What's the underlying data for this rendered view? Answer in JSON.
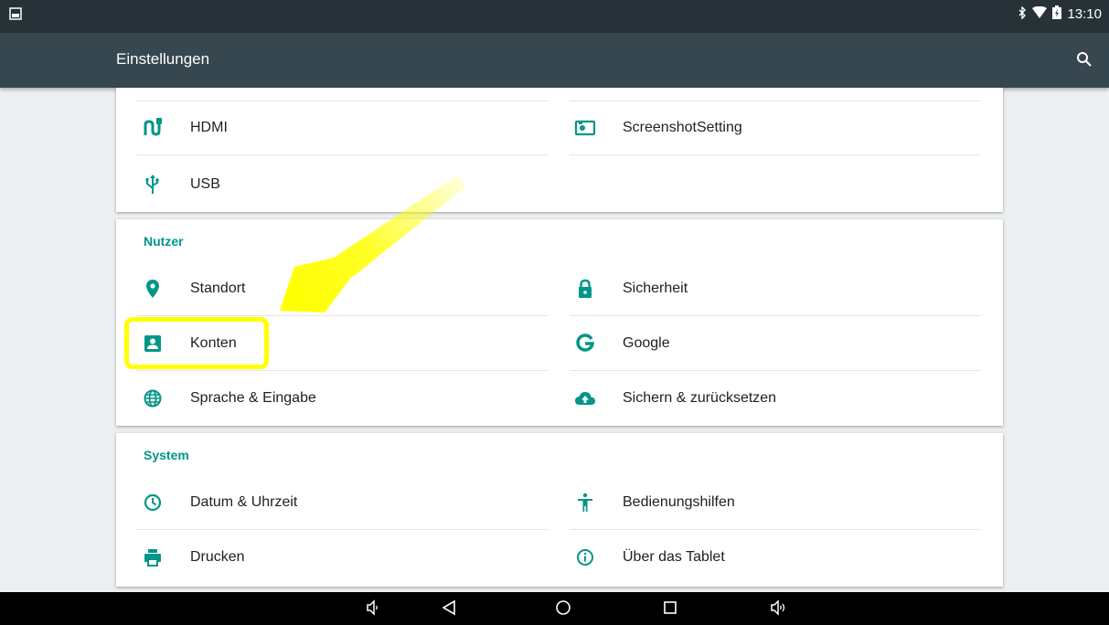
{
  "status": {
    "time": "13:10"
  },
  "appbar": {
    "title": "Einstellungen"
  },
  "device": {
    "items": [
      {
        "icon": "hdmi-icon",
        "label": "HDMI"
      },
      {
        "icon": "screenshot-icon",
        "label": "ScreenshotSetting"
      },
      {
        "icon": "usb-icon",
        "label": "USB"
      }
    ]
  },
  "nutzer": {
    "header": "Nutzer",
    "items": [
      {
        "icon": "location-icon",
        "label": "Standort"
      },
      {
        "icon": "lock-icon",
        "label": "Sicherheit"
      },
      {
        "icon": "account-icon",
        "label": "Konten"
      },
      {
        "icon": "google-icon",
        "label": "Google"
      },
      {
        "icon": "globe-icon",
        "label": "Sprache & Eingabe"
      },
      {
        "icon": "cloud-upload-icon",
        "label": "Sichern & zurücksetzen"
      }
    ]
  },
  "system": {
    "header": "System",
    "items": [
      {
        "icon": "clock-icon",
        "label": "Datum & Uhrzeit"
      },
      {
        "icon": "accessibility-icon",
        "label": "Bedienungshilfen"
      },
      {
        "icon": "print-icon",
        "label": "Drucken"
      },
      {
        "icon": "info-icon",
        "label": "Über das Tablet"
      }
    ]
  },
  "colors": {
    "accent": "#009688",
    "appbar": "#37474f",
    "statusbar": "#263238",
    "highlight": "#ffff00"
  }
}
